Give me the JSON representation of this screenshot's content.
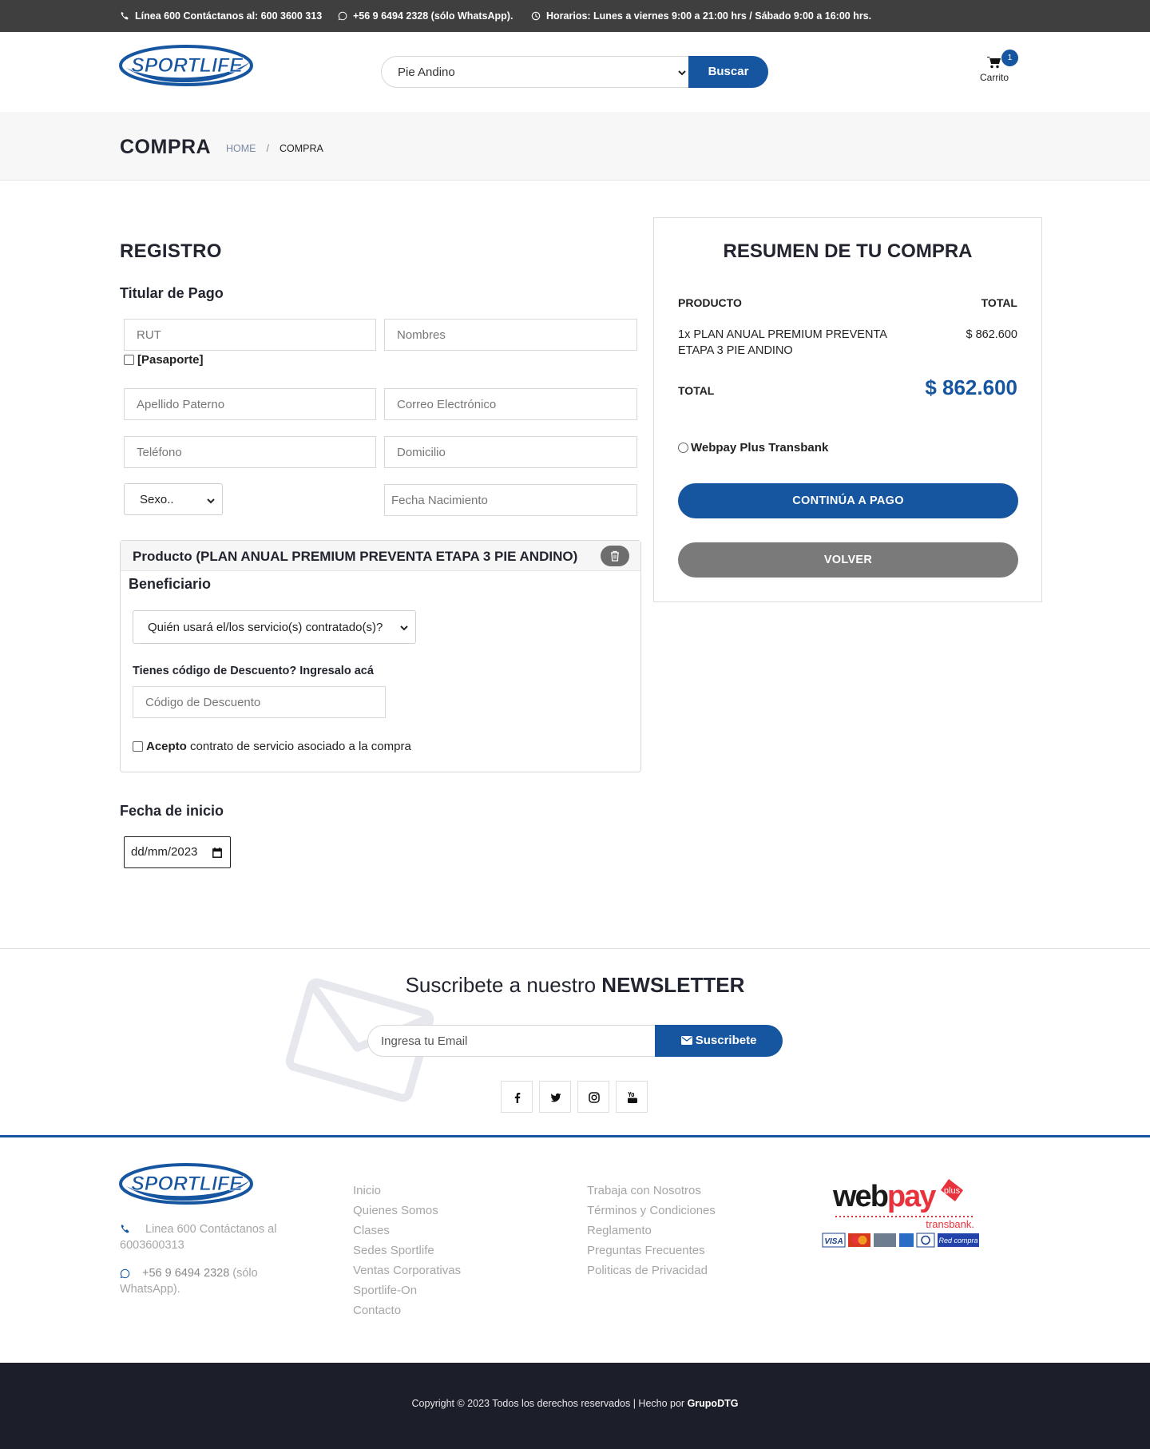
{
  "topbar": {
    "phone": "Línea 600 Contáctanos al: 600 3600 313",
    "whatsapp": "+56 9 6494 2328 (sólo WhatsApp).",
    "hours": "Horarios: Lunes a viernes 9:00 a 21:00 hrs / Sábado 9:00 a 16:00 hrs."
  },
  "header": {
    "logo_text": "SPORTLIFE",
    "search_value": "Pie Andino",
    "search_button": "Buscar",
    "cart_count": "1",
    "cart_label": "Carrito"
  },
  "page": {
    "title": "COMPRA",
    "breadcrumb_home": "HOME",
    "breadcrumb_separator": "/",
    "breadcrumb_current": "COMPRA"
  },
  "registro": {
    "title": "REGISTRO",
    "subtitle": "Titular de Pago",
    "rut_placeholder": "RUT",
    "nombres_placeholder": "Nombres",
    "pasaporte_label": "[Pasaporte]",
    "apellido_placeholder": "Apellido Paterno",
    "correo_placeholder": "Correo Electrónico",
    "telefono_placeholder": "Teléfono",
    "domicilio_placeholder": "Domicilio",
    "sexo_value": "Sexo..",
    "fecha_nac_placeholder": "Fecha Nacimiento"
  },
  "product": {
    "title": "Producto (PLAN ANUAL PREMIUM PREVENTA ETAPA 3 PIE ANDINO)",
    "beneficiario_title": "Beneficiario",
    "beneficiario_select": "Quién usará el/los servicio(s) contratado(s)?",
    "discount_label": "Tienes código de Descuento? Ingresalo acá",
    "discount_placeholder": "Código de Descuento",
    "accept_bold": "Acepto",
    "accept_rest": " contrato de servicio asociado a la compra"
  },
  "start": {
    "title": "Fecha de inicio",
    "date_value": "dd/mm/2023"
  },
  "summary": {
    "title": "RESUMEN DE TU COMPRA",
    "col_product": "PRODUCTO",
    "col_total": "TOTAL",
    "item_line1": "1x PLAN ANUAL PREMIUM PREVENTA",
    "item_line2": "ETAPA 3 PIE ANDINO",
    "item_price": "$ 862.600",
    "total_label": "TOTAL",
    "total_value": "$ 862.600",
    "payment_option": "Webpay Plus Transbank",
    "continue_button": "CONTINÚA A PAGO",
    "back_button": "VOLVER"
  },
  "newsletter": {
    "title_regular": "Suscribete a nuestro ",
    "title_bold": "NEWSLETTER",
    "email_placeholder": "Ingresa tu Email",
    "subscribe_button": "Suscribete"
  },
  "footer": {
    "logo_text": "SPORTLIFE",
    "phone_line1": "Linea 600 Contáctanos al",
    "phone_line2": "6003600313",
    "wa_number": "+56 9 6494 2328",
    "wa_suffix": " (sólo",
    "wa_line2": "WhatsApp).",
    "links_col1": [
      "Inicio",
      "Quienes Somos",
      "Clases",
      "Sedes Sportlife",
      "Ventas Corporativas",
      "Sportlife-On",
      "Contacto"
    ],
    "links_col2": [
      "Trabaja con Nosotros",
      "Términos y Condiciones",
      "Reglamento",
      "Preguntas Frecuentes",
      "Politicas de Privacidad"
    ],
    "webpay_word": "webpay",
    "webpay_plus": "plus",
    "transbank": "transbank.",
    "copyright": "Copyright © 2023 Todos los derechos reservados | Hecho por ",
    "author": "GrupoDTG"
  },
  "colors": {
    "brand_blue": "#1656a0",
    "topbar_bg": "#3f3f3f",
    "button_gray": "#7a7a7a",
    "footer_bg": "#1c1e29",
    "webpay_red": "#e8323c"
  },
  "icons": [
    "phone-icon",
    "whatsapp-icon",
    "clock-icon",
    "cart-icon",
    "trash-icon",
    "calendar-icon",
    "envelope-icon",
    "facebook-icon",
    "twitter-icon",
    "instagram-icon",
    "youtube-icon"
  ]
}
